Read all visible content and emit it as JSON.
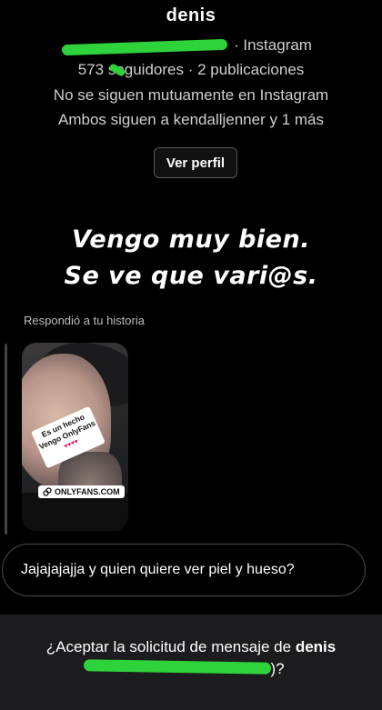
{
  "profile": {
    "name": "denis",
    "username_suffix": "· Instagram",
    "stats": "573 seguidores · 2 publicaciones",
    "mutual_line": "No se siguen mutuamente en Instagram",
    "shared_follow_line": "Ambos siguen a kendalljenner y 1 más",
    "view_profile_label": "Ver perfil"
  },
  "story_overlay": {
    "line1": "Vengo muy bien.",
    "line2": "Se ve que vari@s."
  },
  "reply": {
    "label": "Respondió a tu historia",
    "sticker_line1": "Es un hecho",
    "sticker_line2": "Vengo OnlyFans",
    "sticker_hearts": "♥♥♥♥",
    "link_tag": "ONLYFANS.COM"
  },
  "message": {
    "text": "Jajajajajja y quien quiere ver piel y hueso?"
  },
  "request": {
    "prompt_prefix": "¿Aceptar la solicitud de mensaje de ",
    "prompt_name": "denis",
    "prompt_suffix": ")?"
  },
  "colors": {
    "background": "#000000",
    "scribble": "#2ed23a",
    "accept_bar": "#1c1c1e"
  }
}
